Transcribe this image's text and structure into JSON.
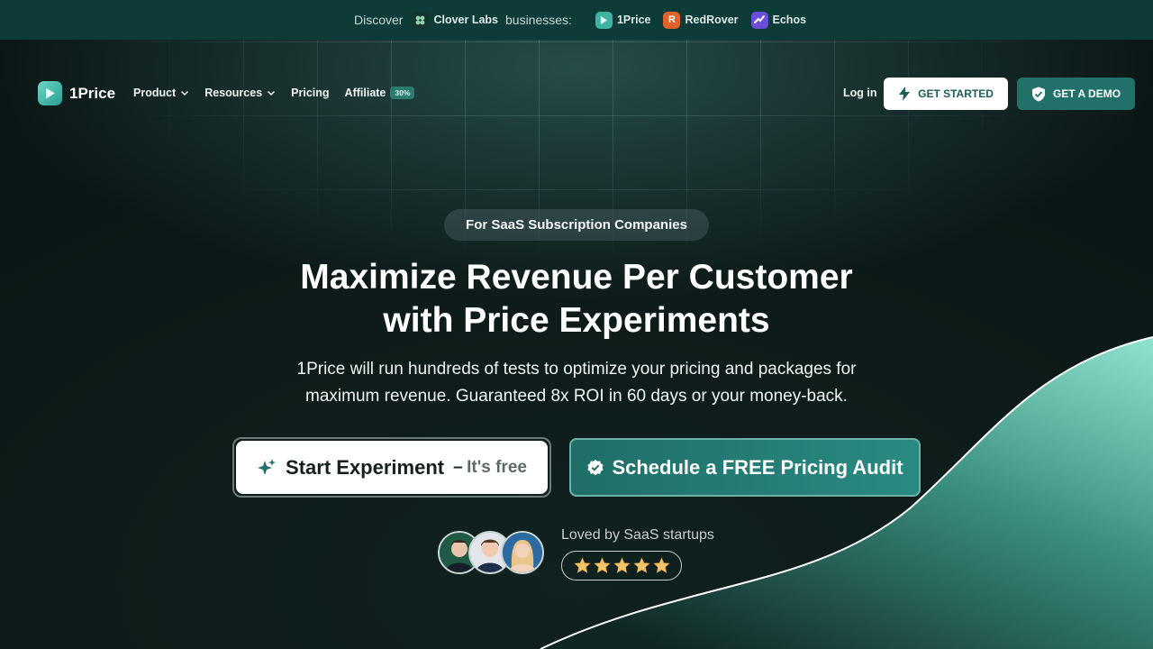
{
  "topbar": {
    "discover": "Discover",
    "parent": "Clover Labs",
    "businesses": "businesses:",
    "brands": [
      {
        "name": "1Price",
        "icon": "1price-logo-icon",
        "color": "#3fb3a3"
      },
      {
        "name": "RedRover",
        "icon": "redrover-logo-icon",
        "color": "#e0632a"
      },
      {
        "name": "Echos",
        "icon": "echos-logo-icon",
        "color": "#6a4ed8"
      }
    ]
  },
  "nav": {
    "logo": "1Price",
    "product": "Product",
    "resources": "Resources",
    "pricing": "Pricing",
    "affiliate": "Affiliate",
    "affiliate_badge": "30%",
    "login": "Log in",
    "get_started": "GET STARTED",
    "get_demo": "GET A DEMO"
  },
  "hero": {
    "pill": "For SaaS Subscription Companies",
    "title_line1": "Maximize Revenue Per Customer",
    "title_line2": "with Price Experiments",
    "subtitle_line1": "1Price will run hundreds of tests to optimize your pricing and packages for",
    "subtitle_line2": "maximum revenue. Guaranteed 8x ROI in 60 days or your money-back.",
    "cta_primary": "Start Experiment",
    "cta_primary_dash": "–",
    "cta_primary_suffix": "It's free",
    "cta_secondary": "Schedule a FREE Pricing Audit",
    "loved_by": "Loved by SaaS startups",
    "rating_stars": 5
  },
  "colors": {
    "accent": "#22706a",
    "topbar": "#0c3b38",
    "background": "#0b1716",
    "star": "#f2c46a"
  }
}
